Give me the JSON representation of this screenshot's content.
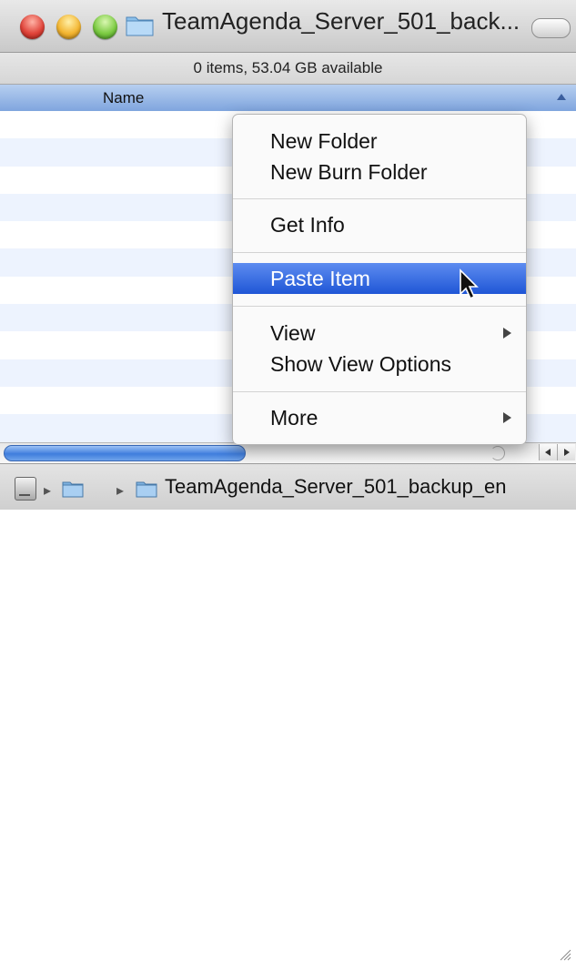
{
  "window": {
    "title": "TeamAgenda_Server_501_back...",
    "status": "0 items, 53.04 GB available"
  },
  "list": {
    "column_header": "Name",
    "row_count": 12
  },
  "context_menu": {
    "items": [
      {
        "label": "New Folder",
        "has_submenu": false
      },
      {
        "label": "New Burn Folder",
        "has_submenu": false
      },
      {
        "label": "Get Info",
        "has_submenu": false
      },
      {
        "label": "Paste Item",
        "has_submenu": false,
        "selected": true
      },
      {
        "label": "View",
        "has_submenu": true
      },
      {
        "label": "Show View Options",
        "has_submenu": false
      },
      {
        "label": "More",
        "has_submenu": true
      }
    ]
  },
  "pathbar": {
    "current_folder": "TeamAgenda_Server_501_backup_en"
  },
  "colors": {
    "selection": "#2f63de",
    "header": "#9dbbe8",
    "stripe": "#edf3fe"
  },
  "icons": [
    "close-light",
    "minimize-light",
    "zoom-light",
    "folder-icon",
    "toolbar-toggle",
    "drive-icon",
    "arrow-cursor"
  ]
}
